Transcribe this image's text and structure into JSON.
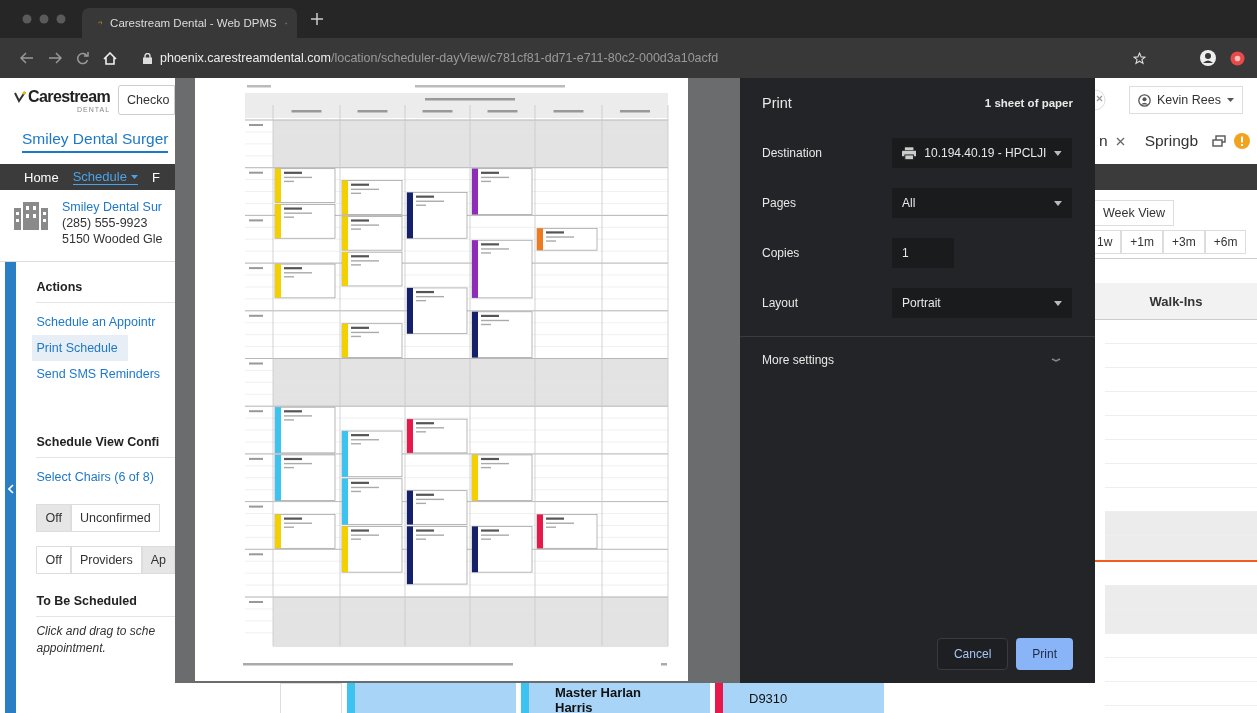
{
  "browser": {
    "tab_title": "Carestream Dental - Web DPMS",
    "url_domain": "phoenix.carestreamdental.com",
    "url_path": "/location/scheduler-dayView/c781cf81-dd71-e711-80c2-000d3a10acfd"
  },
  "app": {
    "logo": "Carestream",
    "logo_sub": "DENTAL",
    "search_value": "Checko",
    "practice_tab": "Smiley Dental Surger",
    "nav": [
      {
        "label": "Home",
        "selected": false
      },
      {
        "label": "Schedule",
        "selected": true
      },
      {
        "label": "F",
        "selected": false
      }
    ],
    "location": {
      "name": "Smiley Dental Sur",
      "phone": "(285) 555-9923",
      "address": "5150 Wooded Gle"
    },
    "actions_title": "Actions",
    "actions": [
      {
        "label": "Schedule an Appointr",
        "selected": false
      },
      {
        "label": "Print Schedule",
        "selected": true
      },
      {
        "label": "Send SMS Reminders",
        "selected": false
      }
    ],
    "view_config_title": "Schedule View Confi",
    "select_chairs": "Select Chairs (6 of 8)",
    "toggle_groups": [
      {
        "buttons": [
          {
            "label": "Off",
            "selected": true
          },
          {
            "label": "Unconfirmed",
            "selected": false
          }
        ]
      },
      {
        "buttons": [
          {
            "label": "Off",
            "selected": false
          },
          {
            "label": "Providers",
            "selected": false
          },
          {
            "label": "Ap",
            "selected": true
          }
        ]
      }
    ],
    "to_be_scheduled_title": "To Be Scheduled",
    "to_be_scheduled_hint": "Click and drag to sche appointment.",
    "user": "Kevin Rees",
    "cut_tab": "n",
    "location_tab": "Springb",
    "week_view": "Week View",
    "jumps": [
      "1w",
      "+1m",
      "+3m",
      "+6m"
    ],
    "walk_ins_header": "Walk-Ins",
    "bottom_cards": [
      {
        "color": "#3cc3ef"
      },
      {
        "title": "Master Harlan Harris",
        "color": "#3cc3ef"
      },
      {
        "code": "D9310",
        "color": "#e8194a"
      }
    ]
  },
  "print": {
    "title": "Print",
    "sheets": "1 sheet of paper",
    "settings": [
      {
        "label": "Destination",
        "value": "10.194.40.19 - HPCLJI",
        "kind": "printer"
      },
      {
        "label": "Pages",
        "value": "All",
        "kind": "select"
      },
      {
        "label": "Copies",
        "value": "1",
        "kind": "number"
      },
      {
        "label": "Layout",
        "value": "Portrait",
        "kind": "select"
      }
    ],
    "more_settings": "More settings",
    "buttons": [
      {
        "label": "Cancel",
        "kind": "secondary"
      },
      {
        "label": "Print",
        "kind": "primary"
      }
    ]
  }
}
